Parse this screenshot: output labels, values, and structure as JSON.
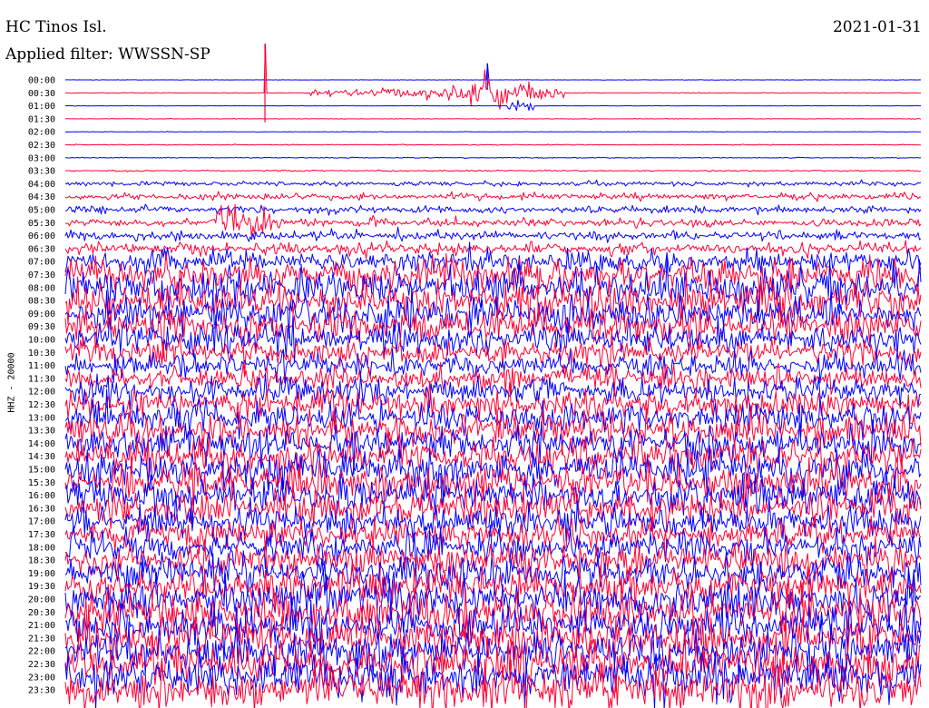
{
  "header": {
    "station": "HC Tinos Isl.",
    "date": "2021-01-31",
    "filter": "Applied filter: WWSSN-SP",
    "channel": "HHZ - 20000"
  },
  "chart_data": {
    "type": "line",
    "title": "HC Tinos Isl.",
    "subtitle": "Applied filter: WWSSN-SP",
    "date": "2021-01-31",
    "ylabel": "HHZ - 20000",
    "xlabel": "",
    "x_range_minutes": [
      0,
      30
    ],
    "rows": [
      "00:00",
      "00:30",
      "01:00",
      "01:30",
      "02:00",
      "02:30",
      "03:00",
      "03:30",
      "04:00",
      "04:30",
      "05:00",
      "05:30",
      "06:00",
      "06:30",
      "07:00",
      "07:30",
      "08:00",
      "08:30",
      "09:00",
      "09:30",
      "10:00",
      "10:30",
      "11:00",
      "11:30",
      "12:00",
      "12:30",
      "13:00",
      "13:30",
      "14:00",
      "14:30",
      "15:00",
      "15:30",
      "16:00",
      "16:30",
      "17:00",
      "17:30",
      "18:00",
      "18:30",
      "19:00",
      "19:30",
      "20:00",
      "20:30",
      "21:00",
      "21:30",
      "22:00",
      "22:30",
      "23:00",
      "23:30"
    ],
    "row_colors": [
      "#0000ff",
      "#ff0033"
    ],
    "relative_noise_amplitude": [
      0.03,
      0.05,
      0.03,
      0.04,
      0.04,
      0.06,
      0.07,
      0.1,
      0.35,
      0.5,
      0.55,
      0.6,
      0.7,
      0.9,
      1.6,
      2.6,
      2.8,
      2.7,
      2.6,
      2.5,
      2.2,
      1.9,
      1.8,
      1.8,
      2.0,
      2.1,
      2.3,
      2.4,
      2.5,
      2.6,
      2.7,
      2.7,
      2.6,
      2.5,
      2.4,
      2.2,
      2.3,
      2.5,
      2.7,
      2.8,
      2.9,
      3.0,
      3.0,
      3.1,
      3.1,
      3.2,
      3.3,
      3.3
    ],
    "events": [
      {
        "row": "00:30",
        "start_min": 8.5,
        "end_min": 17.5,
        "peak_min": 14.7,
        "amplitude": 1.4
      },
      {
        "row": "01:00",
        "start_min": 15.5,
        "end_min": 16.5,
        "peak_min": 15.9,
        "amplitude": 0.4
      },
      {
        "row": "05:30",
        "start_min": 5.2,
        "end_min": 7.5,
        "peak_min": 6.0,
        "amplitude": 1.2
      }
    ],
    "spikes": [
      {
        "row": "00:30",
        "minute": 7.0,
        "amplitude": 9
      },
      {
        "row": "00:00",
        "minute": 14.8,
        "amplitude": 3
      }
    ],
    "grid": false,
    "legend": "none"
  }
}
